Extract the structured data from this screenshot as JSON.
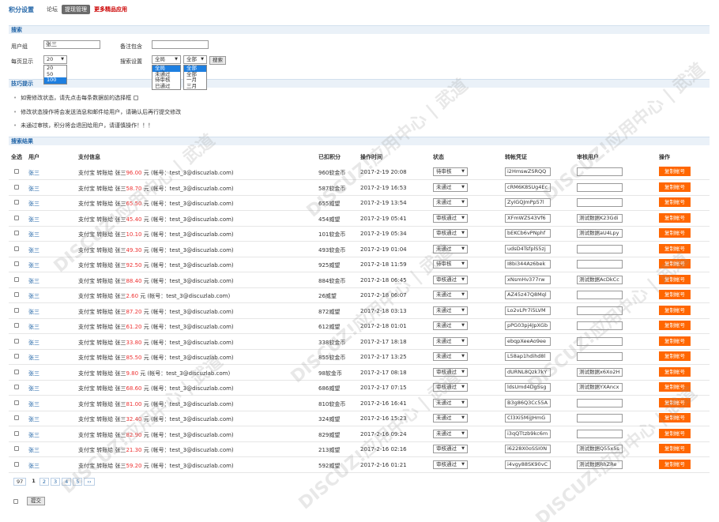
{
  "nav": {
    "title": "积分设置",
    "tabs": [
      "论坛",
      "提现管理",
      "更多精品应用"
    ]
  },
  "search": {
    "section_title": "搜索",
    "user_label": "用户组",
    "user_value": "张三",
    "remark_label": "备注包含",
    "remark_value": "",
    "per_page_label": "每页显示",
    "per_page_value": "20",
    "per_page_options": [
      "20",
      "50",
      "100"
    ],
    "settings_label": "搜索设置",
    "status_value": "全局",
    "status_options": [
      "全局",
      "未通过",
      "待审核",
      "已通过"
    ],
    "period_value": "全部",
    "period_options": [
      "全部",
      "全部",
      "一月",
      "三月"
    ],
    "search_button": "搜索"
  },
  "tips": {
    "section_title": "技巧提示",
    "items": [
      "如需修改状态，请先点击每条数据前的选择框",
      "修改状态操作将会发送消息和邮件给用户，请确认后再行提交修改",
      "未通过审核，积分将会退回给用户，请谨慎操作！！！"
    ]
  },
  "results": {
    "section_title": "搜索结果",
    "headers": [
      "全选",
      "用户",
      "支付信息",
      "已扣积分",
      "操作时间",
      "状态",
      "转帐凭证",
      "审核用户",
      "操作"
    ],
    "rows": [
      {
        "user": "张三",
        "pay_pre": "支付宝 转账给 张三",
        "amount": "96.00",
        "pay_post": " 元 (帐号：test_3@discuzlab.com)",
        "points": "960软金币",
        "time": "2017-2-19 20:08",
        "status": "待审核",
        "cert": "i2HmswZSRQQ",
        "reviewer": "",
        "op": "复制帐号"
      },
      {
        "user": "张三",
        "pay_pre": "支付宝 转账给 张三",
        "amount": "58.70",
        "pay_post": " 元 (帐号：test_3@discuzlab.com)",
        "points": "587软金币",
        "time": "2017-2-19 16:53",
        "status": "未通过",
        "cert": "cRM6K8SUg4Ec",
        "reviewer": "",
        "op": "复制帐号"
      },
      {
        "user": "张三",
        "pay_pre": "支付宝 转账给 张三",
        "amount": "65.50",
        "pay_post": " 元 (帐号：test_3@discuzlab.com)",
        "points": "655威望",
        "time": "2017-2-19 13:54",
        "status": "未通过",
        "cert": "ZyIGQJmPp57l",
        "reviewer": "",
        "op": "复制帐号"
      },
      {
        "user": "张三",
        "pay_pre": "支付宝 转账给 张三",
        "amount": "45.40",
        "pay_post": " 元 (帐号：test_3@discuzlab.com)",
        "points": "454威望",
        "time": "2017-2-19 05:41",
        "status": "审核通过",
        "cert": "XFmWZS43Vf6",
        "reviewer": "测试数据K23Gdi",
        "op": "复制帐号"
      },
      {
        "user": "张三",
        "pay_pre": "支付宝 转账给 张三",
        "amount": "10.10",
        "pay_post": " 元 (帐号：test_3@discuzlab.com)",
        "points": "101软金币",
        "time": "2017-2-19 05:34",
        "status": "审核通过",
        "cert": "bEKCb6vPNphf",
        "reviewer": "测试数据aU4Lpy",
        "op": "复制帐号"
      },
      {
        "user": "张三",
        "pay_pre": "支付宝 转账给 张三",
        "amount": "49.30",
        "pay_post": " 元 (帐号：test_3@discuzlab.com)",
        "points": "493软金币",
        "time": "2017-2-19 01:04",
        "status": "未通过",
        "cert": "udsD4TsfplS5zj",
        "reviewer": "",
        "op": "复制帐号"
      },
      {
        "user": "张三",
        "pay_pre": "支付宝 转账给 张三",
        "amount": "92.50",
        "pay_post": " 元 (帐号：test_3@discuzlab.com)",
        "points": "925威望",
        "time": "2017-2-18 11:59",
        "status": "待审核",
        "cert": "I8bi344Az6bek",
        "reviewer": "",
        "op": "复制帐号"
      },
      {
        "user": "张三",
        "pay_pre": "支付宝 转账给 张三",
        "amount": "88.40",
        "pay_post": " 元 (帐号：test_3@discuzlab.com)",
        "points": "884软金币",
        "time": "2017-2-18 06:45",
        "status": "审核通过",
        "cert": "xNsmHv377rw",
        "reviewer": "测试数据AcDkCc",
        "op": "复制帐号"
      },
      {
        "user": "张三",
        "pay_pre": "支付宝 转账给 张三",
        "amount": "2.60",
        "pay_post": " 元 (帐号：test_3@discuzlab.com)",
        "points": "26威望",
        "time": "2017-2-18 06:07",
        "status": "未通过",
        "cert": "AZ45z47Q8Mql",
        "reviewer": "",
        "op": "复制帐号"
      },
      {
        "user": "张三",
        "pay_pre": "支付宝 转账给 张三",
        "amount": "87.20",
        "pay_post": " 元 (帐号：test_3@discuzlab.com)",
        "points": "872威望",
        "time": "2017-2-18 03:13",
        "status": "未通过",
        "cert": "Lo2vLPr7i5LVM",
        "reviewer": "",
        "op": "复制帐号"
      },
      {
        "user": "张三",
        "pay_pre": "支付宝 转账给 张三",
        "amount": "61.20",
        "pay_post": " 元 (帐号：test_3@discuzlab.com)",
        "points": "612威望",
        "time": "2017-2-18 01:01",
        "status": "未通过",
        "cert": "pPG03pj4JpXGb",
        "reviewer": "",
        "op": "复制帐号"
      },
      {
        "user": "张三",
        "pay_pre": "支付宝 转账给 张三",
        "amount": "33.80",
        "pay_post": " 元 (帐号：test_3@discuzlab.com)",
        "points": "338软金币",
        "time": "2017-2-17 18:18",
        "status": "未通过",
        "cert": "ebqpXeeAo9ee",
        "reviewer": "",
        "op": "复制帐号"
      },
      {
        "user": "张三",
        "pay_pre": "支付宝 转账给 张三",
        "amount": "85.50",
        "pay_post": " 元 (帐号：test_3@discuzlab.com)",
        "points": "855软金币",
        "time": "2017-2-17 13:25",
        "status": "未通过",
        "cert": "L58ap1hdihd8l",
        "reviewer": "",
        "op": "复制帐号"
      },
      {
        "user": "张三",
        "pay_pre": "支付宝 转账给 张三",
        "amount": "9.80",
        "pay_post": " 元 (帐号：test_3@discuzlab.com)",
        "points": "98软金币",
        "time": "2017-2-17 08:18",
        "status": "审核通过",
        "cert": "dURNL8Qzk7kY",
        "reviewer": "测试数据x6Xo2H",
        "op": "复制帐号"
      },
      {
        "user": "张三",
        "pay_pre": "支付宝 转账给 张三",
        "amount": "68.60",
        "pay_post": " 元 (帐号：test_3@discuzlab.com)",
        "points": "686威望",
        "time": "2017-2-17 07:15",
        "status": "审核通过",
        "cert": "ldsUmd4Dg5sg",
        "reviewer": "测试数据YXAncx",
        "op": "复制帐号"
      },
      {
        "user": "张三",
        "pay_pre": "支付宝 转账给 张三",
        "amount": "81.00",
        "pay_post": " 元 (帐号：test_3@discuzlab.com)",
        "points": "810软金币",
        "time": "2017-2-16 16:41",
        "status": "未通过",
        "cert": "B3g86Q3Cc55A",
        "reviewer": "",
        "op": "复制帐号"
      },
      {
        "user": "张三",
        "pay_pre": "支付宝 转账给 张三",
        "amount": "32.40",
        "pay_post": " 元 (帐号：test_3@discuzlab.com)",
        "points": "324威望",
        "time": "2017-2-16 15:23",
        "status": "未通过",
        "cert": "Cl3Xi5MijJHmG",
        "reviewer": "",
        "op": "复制帐号"
      },
      {
        "user": "张三",
        "pay_pre": "支付宝 转账给 张三",
        "amount": "82.90",
        "pay_post": " 元 (帐号：test_3@discuzlab.com)",
        "points": "829威望",
        "time": "2017-2-16 09:24",
        "status": "未通过",
        "cert": "i3qQTtzb9kc6m",
        "reviewer": "",
        "op": "复制帐号"
      },
      {
        "user": "张三",
        "pay_pre": "支付宝 转账给 张三",
        "amount": "21.30",
        "pay_post": " 元 (帐号：test_3@discuzlab.com)",
        "points": "213威望",
        "time": "2017-2-16 02:16",
        "status": "审核通过",
        "cert": "i6228X0oSSI0N",
        "reviewer": "测试数据Q55x5s",
        "op": "复制帐号"
      },
      {
        "user": "张三",
        "pay_pre": "支付宝 转账给 张三",
        "amount": "59.20",
        "pay_post": " 元 (帐号：test_3@discuzlab.com)",
        "points": "592威望",
        "time": "2017-2-16 01:21",
        "status": "审核通过",
        "cert": "i4vgy88SK90vC",
        "reviewer": "测试数据RhZRe",
        "op": "复制帐号"
      }
    ]
  },
  "pager": {
    "total": "97",
    "current": "1",
    "pages": [
      "2",
      "3",
      "4",
      "5"
    ],
    "next": "››"
  },
  "footer": {
    "submit": "提交"
  },
  "watermark": {
    "text": "DISCUZ!应用中心 | 武道"
  }
}
